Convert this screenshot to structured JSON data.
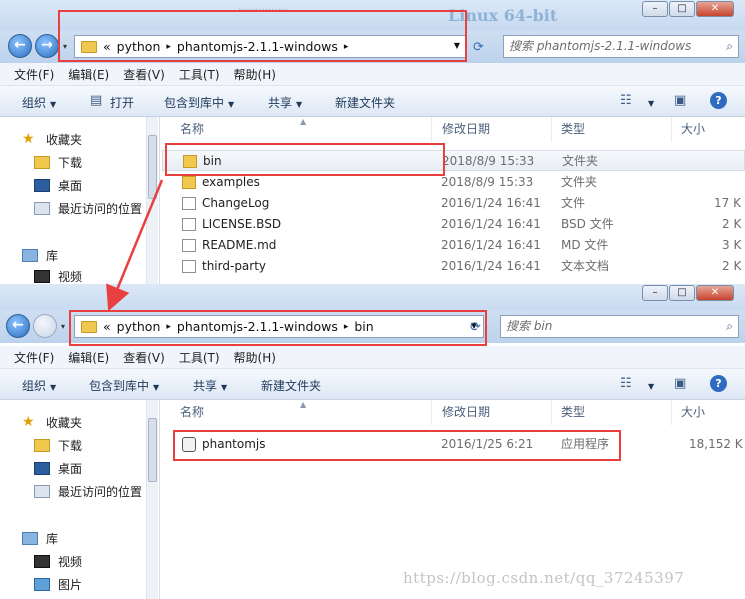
{
  "window1": {
    "glass_text": "Linux 64-bit",
    "glass_text_small": "……………",
    "address": {
      "prefix": "«",
      "crumbs": [
        "python",
        "phantomjs-2.1.1-windows"
      ]
    },
    "search_placeholder": "搜索 phantomjs-2.1.1-windows",
    "menu": [
      "文件(F)",
      "编辑(E)",
      "查看(V)",
      "工具(T)",
      "帮助(H)"
    ],
    "toolbar": {
      "organize": "组织",
      "open": "打开",
      "include": "包含到库中",
      "share": "共享",
      "new_folder": "新建文件夹"
    },
    "nav": {
      "favorites": "收藏夹",
      "downloads": "下载",
      "desktop": "桌面",
      "recent": "最近访问的位置",
      "libraries": "库",
      "videos": "视频"
    },
    "columns": {
      "name": "名称",
      "date": "修改日期",
      "type": "类型",
      "size": "大小"
    },
    "files": [
      {
        "name": "bin",
        "date": "2018/8/9 15:33",
        "type": "文件夹",
        "size": "",
        "icon": "folder"
      },
      {
        "name": "examples",
        "date": "2018/8/9 15:33",
        "type": "文件夹",
        "size": "",
        "icon": "folder"
      },
      {
        "name": "ChangeLog",
        "date": "2016/1/24 16:41",
        "type": "文件",
        "size": "17 K",
        "icon": "file"
      },
      {
        "name": "LICENSE.BSD",
        "date": "2016/1/24 16:41",
        "type": "BSD 文件",
        "size": "2 K",
        "icon": "file"
      },
      {
        "name": "README.md",
        "date": "2016/1/24 16:41",
        "type": "MD 文件",
        "size": "3 K",
        "icon": "file"
      },
      {
        "name": "third-party",
        "date": "2016/1/24 16:41",
        "type": "文本文档",
        "size": "2 K",
        "icon": "text"
      }
    ]
  },
  "window2": {
    "address": {
      "prefix": "«",
      "crumbs": [
        "python",
        "phantomjs-2.1.1-windows",
        "bin"
      ]
    },
    "search_placeholder": "搜索 bin",
    "menu": [
      "文件(F)",
      "编辑(E)",
      "查看(V)",
      "工具(T)",
      "帮助(H)"
    ],
    "toolbar": {
      "organize": "组织",
      "include": "包含到库中",
      "share": "共享",
      "new_folder": "新建文件夹"
    },
    "nav": {
      "favorites": "收藏夹",
      "downloads": "下载",
      "desktop": "桌面",
      "recent": "最近访问的位置",
      "libraries": "库",
      "videos": "视频",
      "pictures": "图片"
    },
    "columns": {
      "name": "名称",
      "date": "修改日期",
      "type": "类型",
      "size": "大小"
    },
    "files": [
      {
        "name": "phantomjs",
        "date": "2016/1/25 6:21",
        "type": "应用程序",
        "size": "18,152 K",
        "icon": "exe"
      }
    ]
  },
  "window_controls": {
    "minimize": "–",
    "maximize": "□",
    "close": "✕"
  },
  "watermark": "https://blog.csdn.net/qq_37245397",
  "colors": {
    "highlight": "#e8403f",
    "selection": "#e8edf4",
    "accent": "#2f6cc0"
  }
}
